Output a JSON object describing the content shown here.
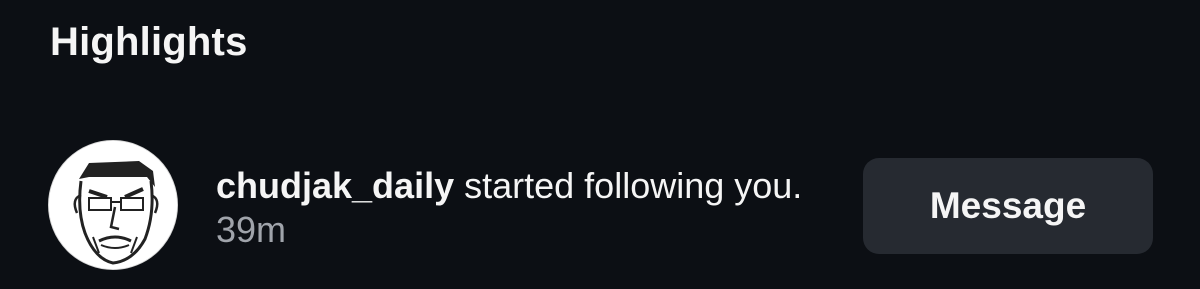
{
  "section": {
    "title": "Highlights"
  },
  "notification": {
    "username": "chudjak_daily",
    "action_text": " started following you.",
    "timestamp": "39m",
    "avatar_icon": "wojak-face-avatar",
    "button_label": "Message"
  },
  "colors": {
    "background": "#0c0f14",
    "text_primary": "#f5f5f5",
    "text_secondary": "#a0a4ab",
    "button_bg": "#262a31"
  }
}
